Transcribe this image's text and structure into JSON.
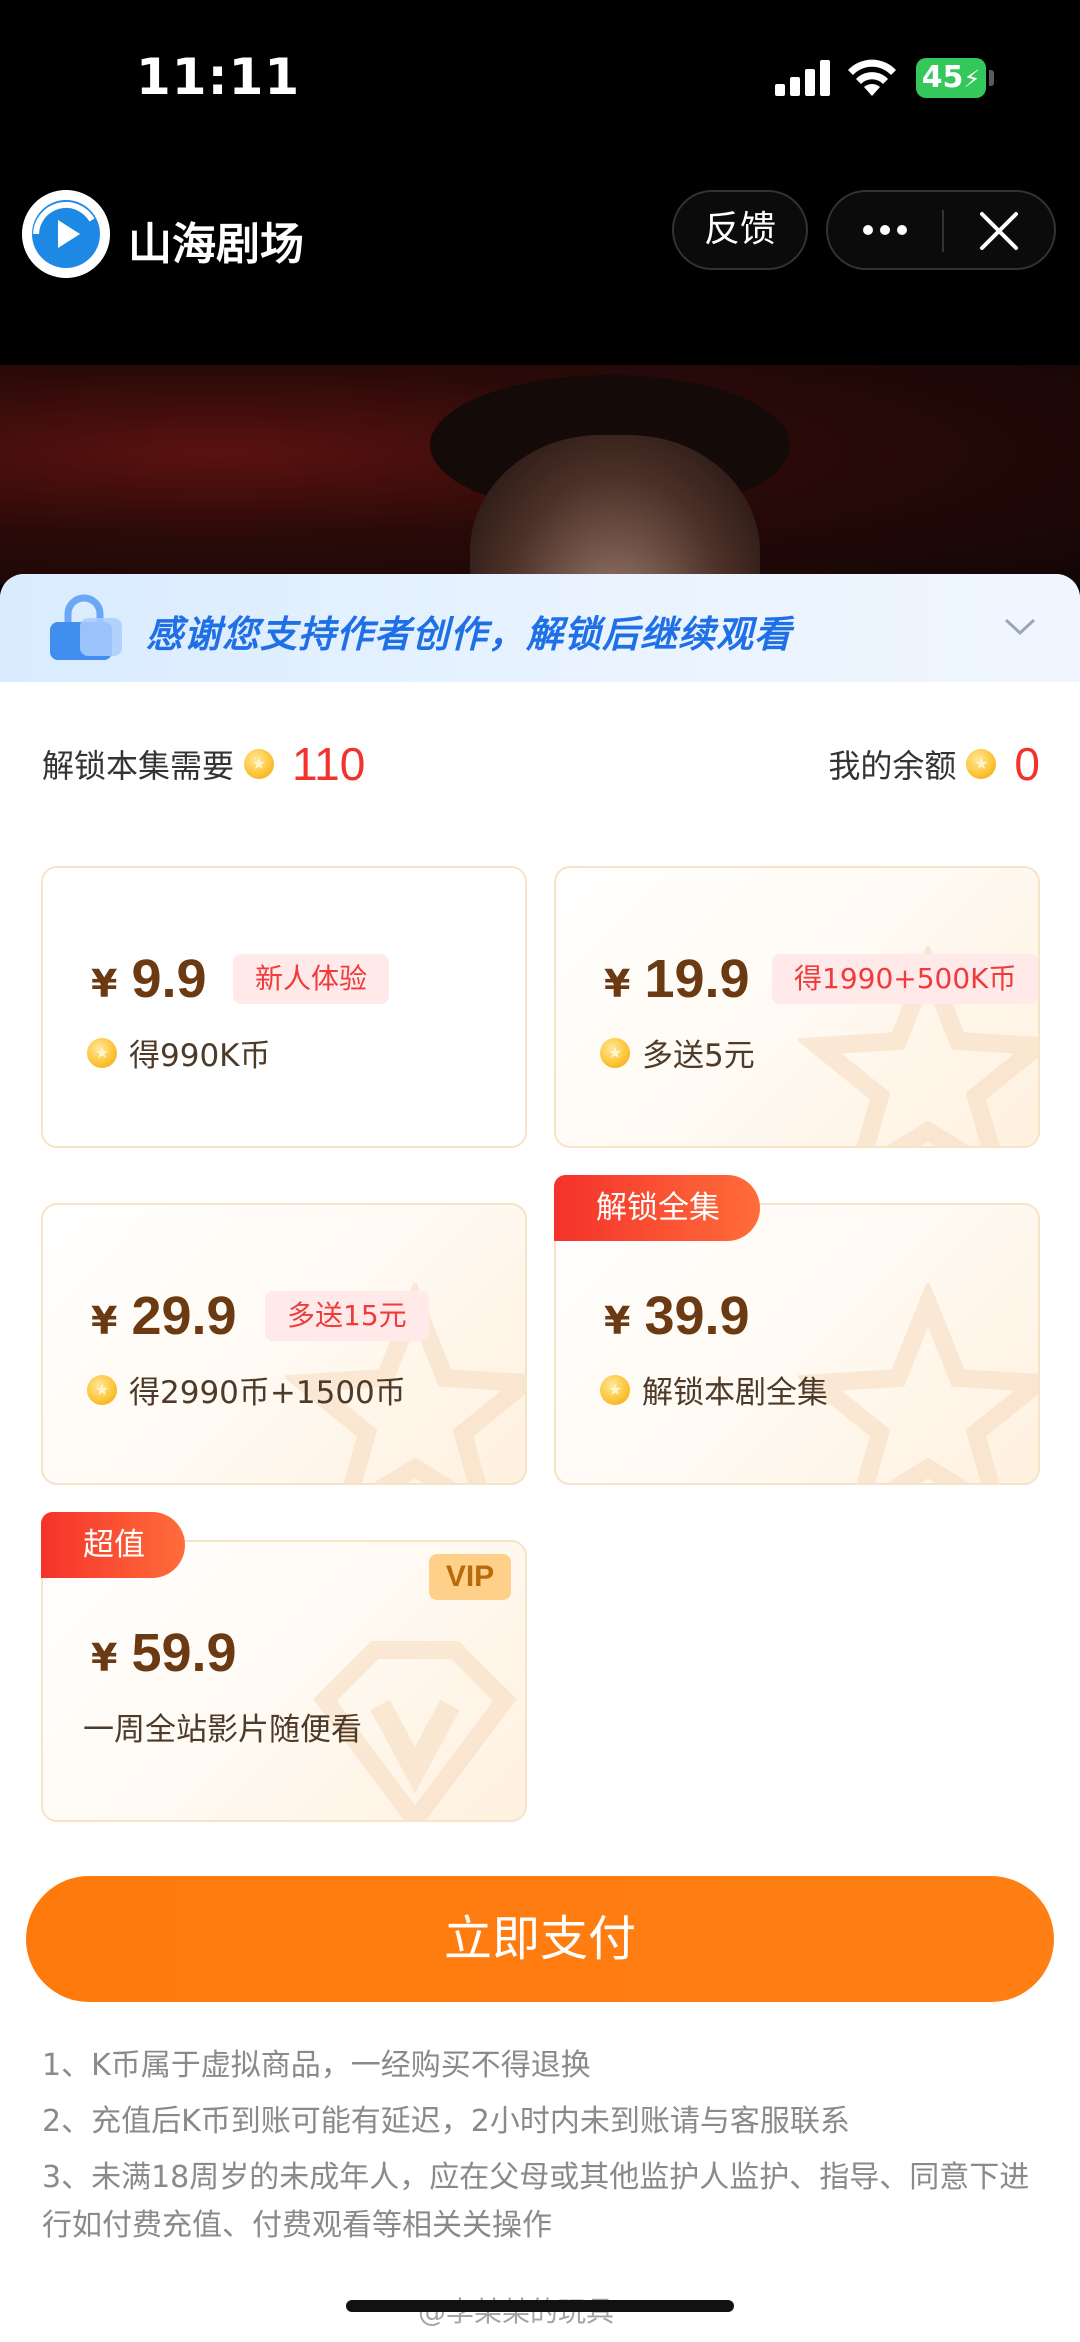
{
  "status_bar": {
    "time": "11:11",
    "battery": "45"
  },
  "header": {
    "app_name": "山海剧场",
    "feedback_label": "反馈",
    "more_label": "•••"
  },
  "banner": {
    "text": "感谢您支持作者创作，解锁后继续观看"
  },
  "unlock": {
    "need_label": "解锁本集需要",
    "need_value": "110",
    "balance_label": "我的余额",
    "balance_value": "0"
  },
  "packages": [
    {
      "yen": "¥",
      "price": "9.9",
      "badge": "新人体验",
      "desc": "得990K币"
    },
    {
      "yen": "¥",
      "price": "19.9",
      "badge": "得1990+500K币",
      "desc": "多送5元"
    },
    {
      "yen": "¥",
      "price": "29.9",
      "badge": "多送15元",
      "desc": "得2990币+1500币"
    },
    {
      "yen": "¥",
      "price": "39.9",
      "tag": "解锁全集",
      "desc": "解锁本剧全集"
    },
    {
      "yen": "¥",
      "price": "59.9",
      "tag": "超值",
      "vip": "VIP",
      "desc": "一周全站影片随便看"
    }
  ],
  "pay_button": "立即支付",
  "notes": [
    "1、K币属于虚拟商品，一经购买不得退换",
    "2、充值后K币到账可能有延迟，2小时内未到账请与客服联系",
    "3、未满18周岁的未成年人，应在父母或其他监护人监护、指导、同意下进行如付费充值、付费观看等相关关操作"
  ],
  "watermark": "@李某某的玩具",
  "colors": {
    "accent_orange": "#ff7a0c",
    "price_brown": "#6b3a12",
    "alert_red": "#f2322d",
    "banner_blue": "#1f6fe6"
  }
}
